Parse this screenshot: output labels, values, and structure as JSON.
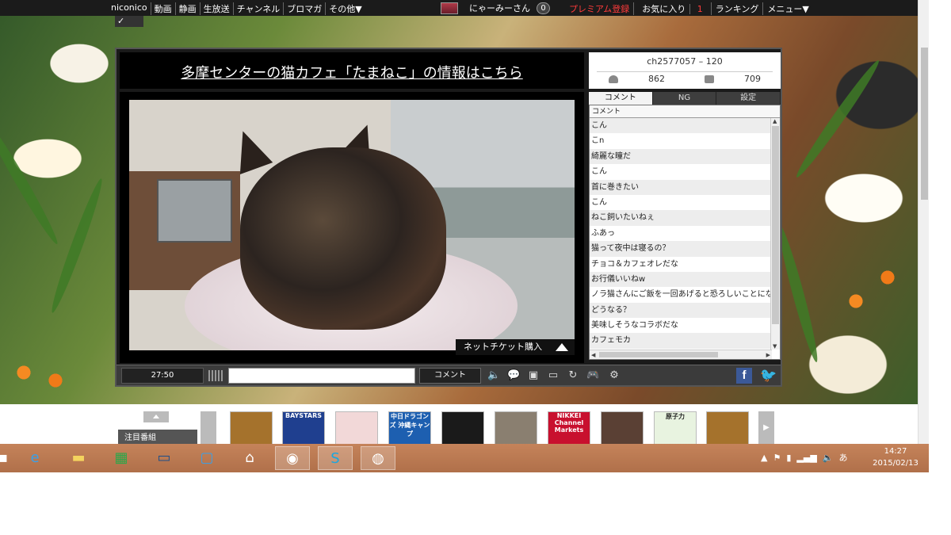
{
  "topbar": {
    "nav": [
      "niconico",
      "動画",
      "静画",
      "生放送",
      "チャンネル",
      "ブロマガ",
      "その他▼"
    ],
    "username": "にゃーみーさん",
    "notification_count": "0",
    "premium": "プレミアム登録",
    "favorites": "お気に入り",
    "favorites_count": "1",
    "ranking": "ランキング",
    "menu": "メニュー▼"
  },
  "player": {
    "ad_link": "多摩センターの猫カフェ「たまねこ」の情報はこちら",
    "channel_id": "ch2577057 – 120",
    "viewers": "862",
    "comments_count": "709",
    "ticket_label": "ネットチケット購入",
    "time": "27:50",
    "comment_button": "コメント",
    "comment_input_placeholder": "",
    "tabs": [
      "コメント",
      "NG",
      "設定"
    ],
    "comment_header": "コメント",
    "comments": [
      "こん",
      "こn",
      "綺麗な瞳だ",
      "こん",
      "首に巻きたい",
      "こん",
      "ねこ飼いたいねぇ",
      "ふあっ",
      "猫って夜中は寝るの？",
      "チョコ＆カフェオレだな",
      "お行儀いいねw",
      "ノラ猫さんにご飯を一回あげると恐ろしいことになるよ",
      "どうなる？",
      "美味しそうなコラボだな",
      "カフェモカ"
    ]
  },
  "attention": {
    "label": "注目番組",
    "thumbs": [
      {
        "label": "",
        "color": "#a5722c"
      },
      {
        "label": "BAYSTARS",
        "color": "#1f3f8f"
      },
      {
        "label": "",
        "color": "#f2d8d8"
      },
      {
        "label": "中日ドラゴンズ 沖縄キャンプ",
        "color": "#1d5fb0"
      },
      {
        "label": "",
        "color": "#1a1a1a"
      },
      {
        "label": "",
        "color": "#8a7f70"
      },
      {
        "label": "NIKKEI Channel Markets",
        "color": "#c8102e"
      },
      {
        "label": "",
        "color": "#5a4034"
      },
      {
        "label": "原子力",
        "color": "#e8f3e0"
      },
      {
        "label": "",
        "color": "#a5722c"
      }
    ]
  },
  "taskbar": {
    "icons": [
      "start-icon",
      "ie-icon",
      "explorer-icon",
      "store-icon",
      "lenovo-icon",
      "shop-icon",
      "home-icon",
      "thunderbird-icon",
      "skype-icon",
      "chrome-icon"
    ],
    "ime": "あ",
    "time": "14:27",
    "date": "2015/02/13"
  }
}
